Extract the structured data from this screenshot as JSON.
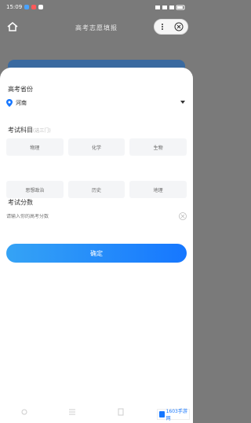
{
  "status_bar": {
    "time": "15:09",
    "right_text": "网络信号"
  },
  "header": {
    "title": "高考志愿填报"
  },
  "sheet": {
    "province_title": "高考省份",
    "province_value": "河南",
    "subjects_title": "考试科目",
    "subjects_hint": "(选三门)",
    "subjects": [
      "物理",
      "化学",
      "生物",
      "思想政治",
      "历史",
      "地理"
    ],
    "score_title": "考试分数",
    "score_placeholder": "请输入你的高考分数",
    "submit_label": "确定"
  },
  "watermark": {
    "label": "1603手游网"
  },
  "colors": {
    "accent": "#1677ff",
    "accent_light": "#35a3f5",
    "overlay": "#7a7a7a"
  }
}
